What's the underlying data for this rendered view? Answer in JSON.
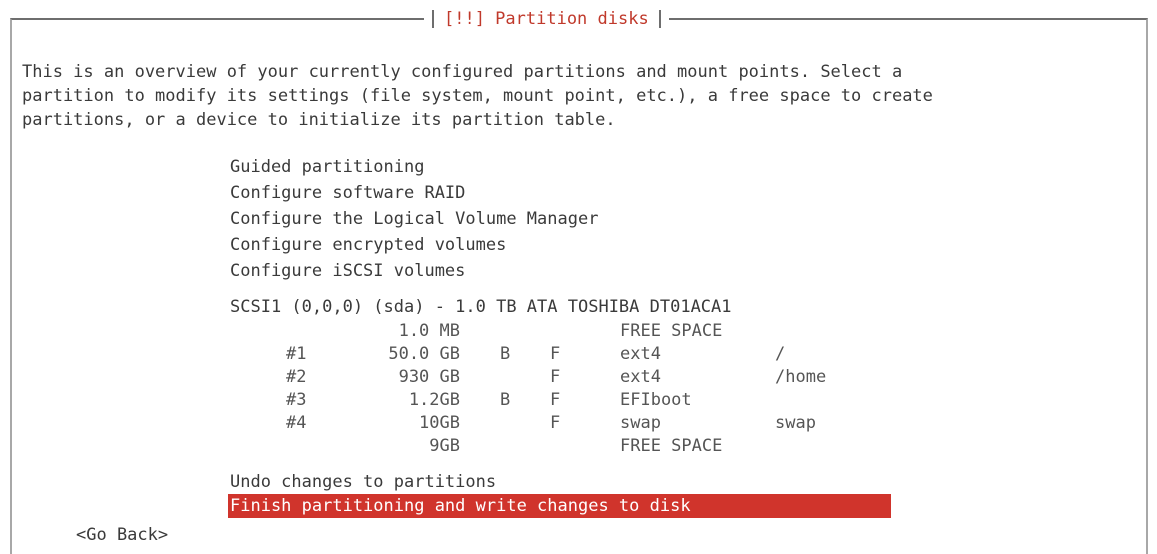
{
  "dialog": {
    "title": "[!!] Partition disks",
    "description": "This is an overview of your currently configured partitions and mount points. Select a\npartition to modify its settings (file system, mount point, etc.), a free space to create\npartitions, or a device to initialize its partition table."
  },
  "menu": [
    "Guided partitioning",
    "Configure software RAID",
    "Configure the Logical Volume Manager",
    "Configure encrypted volumes",
    "Configure iSCSI volumes"
  ],
  "disk": {
    "header": "SCSI1 (0,0,0) (sda) - 1.0 TB ATA TOSHIBA DT01ACA1",
    "partitions": [
      {
        "num": "",
        "size": "1.0 MB",
        "boot": "",
        "format": "",
        "fs": "FREE SPACE",
        "mount": ""
      },
      {
        "num": "#1",
        "size": "50.0 GB",
        "boot": "B",
        "format": "F",
        "fs": "ext4",
        "mount": "/"
      },
      {
        "num": "#2",
        "size": "930 GB",
        "boot": "",
        "format": "F",
        "fs": "ext4",
        "mount": "/home"
      },
      {
        "num": "#3",
        "size": "1.2GB",
        "boot": "B",
        "format": "F",
        "fs": "EFIboot",
        "mount": ""
      },
      {
        "num": "#4",
        "size": "10GB",
        "boot": "",
        "format": "F",
        "fs": "swap",
        "mount": "swap"
      },
      {
        "num": "",
        "size": "9GB",
        "boot": "",
        "format": "",
        "fs": "FREE SPACE",
        "mount": ""
      }
    ]
  },
  "actions": {
    "undo": "Undo changes to partitions",
    "finish": "Finish partitioning and write changes to disk"
  },
  "go_back": "<Go Back>",
  "colors": {
    "highlight": "#d0342c",
    "title": "#c0392b",
    "border": "#6e6e6e"
  }
}
